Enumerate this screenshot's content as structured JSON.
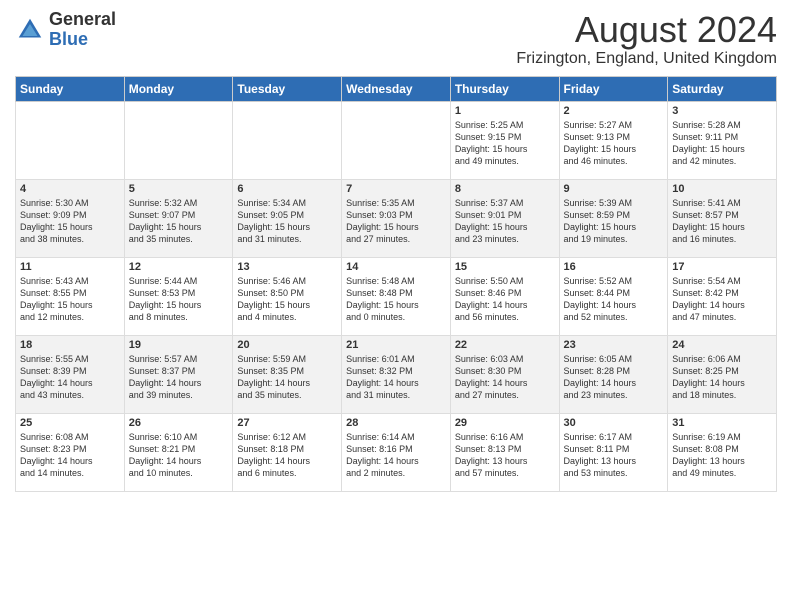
{
  "header": {
    "logo_general": "General",
    "logo_blue": "Blue",
    "month_year": "August 2024",
    "location": "Frizington, England, United Kingdom"
  },
  "days_of_week": [
    "Sunday",
    "Monday",
    "Tuesday",
    "Wednesday",
    "Thursday",
    "Friday",
    "Saturday"
  ],
  "weeks": [
    [
      {
        "day": "",
        "info": ""
      },
      {
        "day": "",
        "info": ""
      },
      {
        "day": "",
        "info": ""
      },
      {
        "day": "",
        "info": ""
      },
      {
        "day": "1",
        "info": "Sunrise: 5:25 AM\nSunset: 9:15 PM\nDaylight: 15 hours\nand 49 minutes."
      },
      {
        "day": "2",
        "info": "Sunrise: 5:27 AM\nSunset: 9:13 PM\nDaylight: 15 hours\nand 46 minutes."
      },
      {
        "day": "3",
        "info": "Sunrise: 5:28 AM\nSunset: 9:11 PM\nDaylight: 15 hours\nand 42 minutes."
      }
    ],
    [
      {
        "day": "4",
        "info": "Sunrise: 5:30 AM\nSunset: 9:09 PM\nDaylight: 15 hours\nand 38 minutes."
      },
      {
        "day": "5",
        "info": "Sunrise: 5:32 AM\nSunset: 9:07 PM\nDaylight: 15 hours\nand 35 minutes."
      },
      {
        "day": "6",
        "info": "Sunrise: 5:34 AM\nSunset: 9:05 PM\nDaylight: 15 hours\nand 31 minutes."
      },
      {
        "day": "7",
        "info": "Sunrise: 5:35 AM\nSunset: 9:03 PM\nDaylight: 15 hours\nand 27 minutes."
      },
      {
        "day": "8",
        "info": "Sunrise: 5:37 AM\nSunset: 9:01 PM\nDaylight: 15 hours\nand 23 minutes."
      },
      {
        "day": "9",
        "info": "Sunrise: 5:39 AM\nSunset: 8:59 PM\nDaylight: 15 hours\nand 19 minutes."
      },
      {
        "day": "10",
        "info": "Sunrise: 5:41 AM\nSunset: 8:57 PM\nDaylight: 15 hours\nand 16 minutes."
      }
    ],
    [
      {
        "day": "11",
        "info": "Sunrise: 5:43 AM\nSunset: 8:55 PM\nDaylight: 15 hours\nand 12 minutes."
      },
      {
        "day": "12",
        "info": "Sunrise: 5:44 AM\nSunset: 8:53 PM\nDaylight: 15 hours\nand 8 minutes."
      },
      {
        "day": "13",
        "info": "Sunrise: 5:46 AM\nSunset: 8:50 PM\nDaylight: 15 hours\nand 4 minutes."
      },
      {
        "day": "14",
        "info": "Sunrise: 5:48 AM\nSunset: 8:48 PM\nDaylight: 15 hours\nand 0 minutes."
      },
      {
        "day": "15",
        "info": "Sunrise: 5:50 AM\nSunset: 8:46 PM\nDaylight: 14 hours\nand 56 minutes."
      },
      {
        "day": "16",
        "info": "Sunrise: 5:52 AM\nSunset: 8:44 PM\nDaylight: 14 hours\nand 52 minutes."
      },
      {
        "day": "17",
        "info": "Sunrise: 5:54 AM\nSunset: 8:42 PM\nDaylight: 14 hours\nand 47 minutes."
      }
    ],
    [
      {
        "day": "18",
        "info": "Sunrise: 5:55 AM\nSunset: 8:39 PM\nDaylight: 14 hours\nand 43 minutes."
      },
      {
        "day": "19",
        "info": "Sunrise: 5:57 AM\nSunset: 8:37 PM\nDaylight: 14 hours\nand 39 minutes."
      },
      {
        "day": "20",
        "info": "Sunrise: 5:59 AM\nSunset: 8:35 PM\nDaylight: 14 hours\nand 35 minutes."
      },
      {
        "day": "21",
        "info": "Sunrise: 6:01 AM\nSunset: 8:32 PM\nDaylight: 14 hours\nand 31 minutes."
      },
      {
        "day": "22",
        "info": "Sunrise: 6:03 AM\nSunset: 8:30 PM\nDaylight: 14 hours\nand 27 minutes."
      },
      {
        "day": "23",
        "info": "Sunrise: 6:05 AM\nSunset: 8:28 PM\nDaylight: 14 hours\nand 23 minutes."
      },
      {
        "day": "24",
        "info": "Sunrise: 6:06 AM\nSunset: 8:25 PM\nDaylight: 14 hours\nand 18 minutes."
      }
    ],
    [
      {
        "day": "25",
        "info": "Sunrise: 6:08 AM\nSunset: 8:23 PM\nDaylight: 14 hours\nand 14 minutes."
      },
      {
        "day": "26",
        "info": "Sunrise: 6:10 AM\nSunset: 8:21 PM\nDaylight: 14 hours\nand 10 minutes."
      },
      {
        "day": "27",
        "info": "Sunrise: 6:12 AM\nSunset: 8:18 PM\nDaylight: 14 hours\nand 6 minutes."
      },
      {
        "day": "28",
        "info": "Sunrise: 6:14 AM\nSunset: 8:16 PM\nDaylight: 14 hours\nand 2 minutes."
      },
      {
        "day": "29",
        "info": "Sunrise: 6:16 AM\nSunset: 8:13 PM\nDaylight: 13 hours\nand 57 minutes."
      },
      {
        "day": "30",
        "info": "Sunrise: 6:17 AM\nSunset: 8:11 PM\nDaylight: 13 hours\nand 53 minutes."
      },
      {
        "day": "31",
        "info": "Sunrise: 6:19 AM\nSunset: 8:08 PM\nDaylight: 13 hours\nand 49 minutes."
      }
    ]
  ]
}
